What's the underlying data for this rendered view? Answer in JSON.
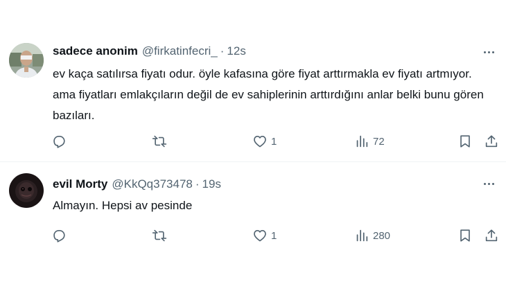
{
  "tweets": [
    {
      "name": "sadece anonim",
      "handle": "@firkatinfecri_",
      "separator": "·",
      "time": "12s",
      "text": "ev kaça satılırsa fiyatı odur. öyle kafasına göre fiyat arttırmakla ev fiyatı artmıyor. ama fiyatları emlakçıların değil de ev sahiplerinin arttırdığını anlar belki bunu gören bazıları.",
      "reply_count": "",
      "retweet_count": "",
      "like_count": "1",
      "view_count": "72"
    },
    {
      "name": "evil Morty",
      "handle": "@KkQq373478",
      "separator": "·",
      "time": "19s",
      "text": "Almayın. Hepsi av pesinde",
      "reply_count": "",
      "retweet_count": "",
      "like_count": "1",
      "view_count": "280"
    }
  ],
  "colors": {
    "text_primary": "#0f1419",
    "text_secondary": "#536471",
    "divider": "#eff3f4",
    "background": "#ffffff"
  },
  "icons": {
    "more": "more-horizontal-icon",
    "reply": "reply-icon",
    "retweet": "retweet-icon",
    "like": "heart-icon",
    "views": "views-chart-icon",
    "bookmark": "bookmark-icon",
    "share": "share-icon"
  }
}
